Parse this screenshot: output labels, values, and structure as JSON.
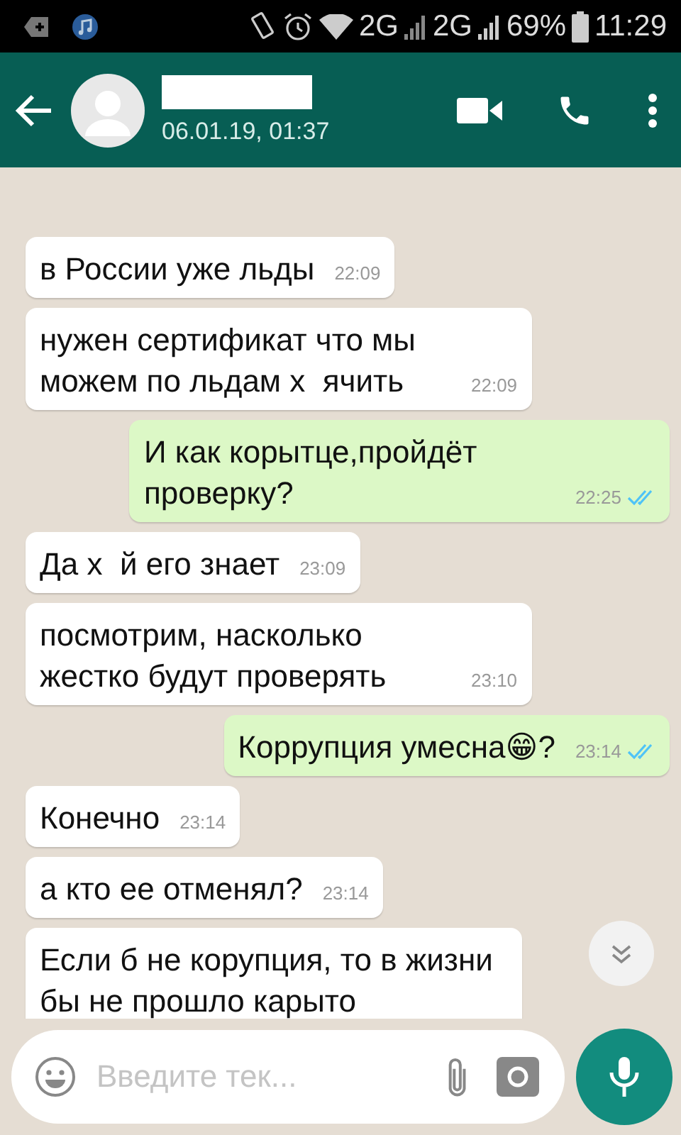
{
  "status_bar": {
    "network_1": "2G",
    "network_2": "2G",
    "battery": "69%",
    "time": "11:29"
  },
  "header": {
    "subtitle": "06.01.19, 01:37",
    "name_redacted": true
  },
  "messages": [
    {
      "kind": "incoming",
      "text": "в России уже льды",
      "time": "22:09"
    },
    {
      "kind": "incoming",
      "text": "нужен сертификат что мы можем по льдам х  ячить",
      "time": "22:09"
    },
    {
      "kind": "outgoing",
      "text": "И как корытце,пройдёт проверку?",
      "time": "22:25",
      "read": true
    },
    {
      "kind": "incoming",
      "text": "Да х  й его знает",
      "time": "23:09"
    },
    {
      "kind": "incoming",
      "text": "посмотрим, насколько жестко будут проверять",
      "time": "23:10"
    },
    {
      "kind": "outgoing",
      "text": "Коррупция умесна😁?",
      "time": "23:14",
      "read": true
    },
    {
      "kind": "incoming",
      "text": "Конечно",
      "time": "23:14"
    },
    {
      "kind": "incoming",
      "text": "а кто ее отменял?",
      "time": "23:14"
    },
    {
      "kind": "incoming",
      "text": "Если б не корупция, то в жизни бы не прошло карыто"
    }
  ],
  "composer": {
    "placeholder": "Введите тек..."
  }
}
